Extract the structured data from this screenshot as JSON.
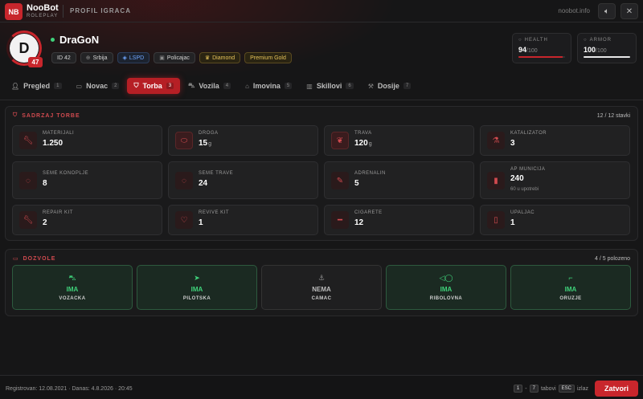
{
  "app": {
    "logo": "NB",
    "name": "NooBot",
    "sub": "ROLEPLAY",
    "page_title": "PROFIL IGRACA",
    "site": "noobot.info"
  },
  "player": {
    "initial": "D",
    "level": "47",
    "name": "DraGoN",
    "chips": [
      {
        "label": "ID 42"
      },
      {
        "label": "Srbija"
      },
      {
        "label": "LSPD"
      },
      {
        "label": "Policajac"
      },
      {
        "label": "Diamond"
      },
      {
        "label": "Premium Gold"
      }
    ]
  },
  "stats": {
    "health": {
      "label": "HEALTH",
      "value": "94",
      "max": "/100",
      "fraction": 0.94
    },
    "armor": {
      "label": "ARMOR",
      "value": "100",
      "max": "/100",
      "fraction": 1.0
    }
  },
  "tabs": [
    {
      "label": "Pregled",
      "num": "1"
    },
    {
      "label": "Novac",
      "num": "2"
    },
    {
      "label": "Torba",
      "num": "3"
    },
    {
      "label": "Vozila",
      "num": "4"
    },
    {
      "label": "Imovina",
      "num": "5"
    },
    {
      "label": "Skillovi",
      "num": "6"
    },
    {
      "label": "Dosije",
      "num": "7"
    }
  ],
  "bag": {
    "title": "SADRZAJ TORBE",
    "count": "12 / 12 stavki",
    "items": [
      {
        "label": "MATERIJALI",
        "value": "1.250",
        "unit": "",
        "icon": "wrench-icon"
      },
      {
        "label": "DROGA",
        "value": "15",
        "unit": "g",
        "icon": "pill-icon"
      },
      {
        "label": "TRAVA",
        "value": "120",
        "unit": "g",
        "icon": "leaf-icon"
      },
      {
        "label": "KATALIZATOR",
        "value": "3",
        "unit": "",
        "icon": "flask-icon"
      },
      {
        "label": "SEME KONOPLJE",
        "value": "8",
        "unit": "",
        "icon": "seed-icon"
      },
      {
        "label": "SEME TRAVE",
        "value": "24",
        "unit": "",
        "icon": "seed-icon"
      },
      {
        "label": "ADRENALIN",
        "value": "5",
        "unit": "",
        "icon": "syringe-icon"
      },
      {
        "label": "AP MUNICIJA",
        "value": "240",
        "unit": "",
        "icon": "bullet-icon",
        "sub": "60 u upotrebi"
      },
      {
        "label": "REPAIR KIT",
        "value": "2",
        "unit": "",
        "icon": "wrench-icon"
      },
      {
        "label": "REVIVE KIT",
        "value": "1",
        "unit": "",
        "icon": "heart-icon"
      },
      {
        "label": "CIGARETE",
        "value": "12",
        "unit": "",
        "icon": "cigarette-icon"
      },
      {
        "label": "UPALJAC",
        "value": "1",
        "unit": "",
        "icon": "lighter-icon"
      }
    ]
  },
  "permits": {
    "title": "DOZVOLE",
    "count": "4 / 5 polozeno",
    "items": [
      {
        "status": "IMA",
        "name": "VOZACKA",
        "has": true,
        "icon": "car-icon"
      },
      {
        "status": "IMA",
        "name": "PILOTSKA",
        "has": true,
        "icon": "plane-icon"
      },
      {
        "status": "NEMA",
        "name": "CAMAC",
        "has": false,
        "icon": "boat-icon"
      },
      {
        "status": "IMA",
        "name": "RIBOLOVNA",
        "has": true,
        "icon": "fish-icon"
      },
      {
        "status": "IMA",
        "name": "ORUZJE",
        "has": true,
        "icon": "gun-icon"
      }
    ]
  },
  "footer": {
    "registered": "Registrovan: 12.08.2021 · Danas: 4.8.2026 · 20:45",
    "key_from": "1",
    "key_dash": "-",
    "key_to": "7",
    "tabs_label": "tabovi",
    "esc_key": "ESC",
    "exit_label": "izlaz",
    "close_button": "Zatvori"
  }
}
